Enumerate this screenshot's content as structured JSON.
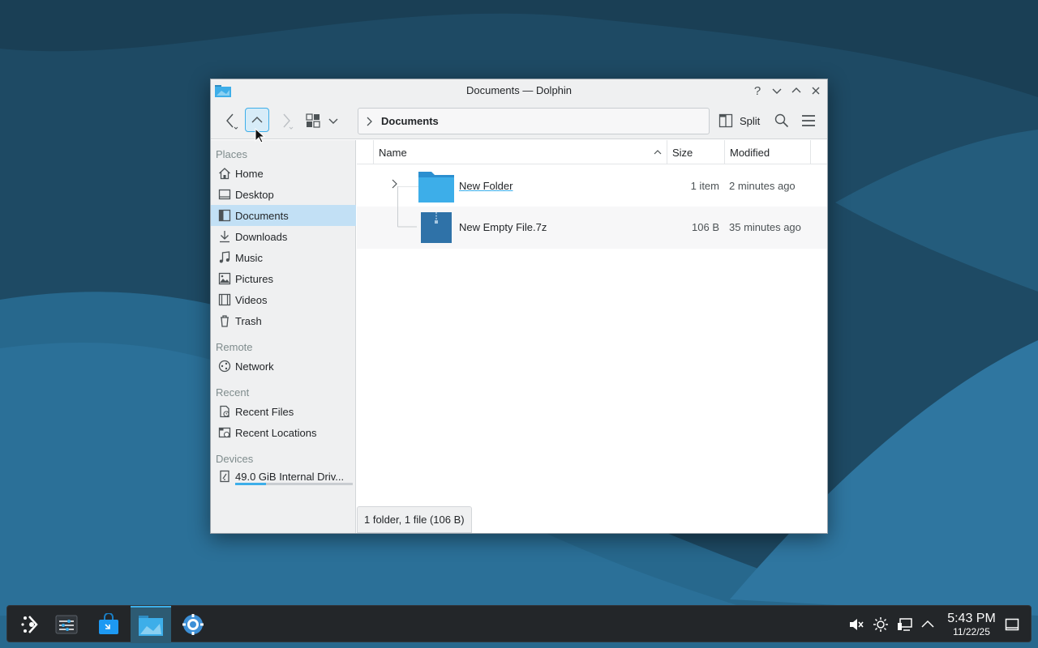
{
  "window": {
    "title": "Documents — Dolphin",
    "buttons": [
      "help-icon",
      "minimize-icon",
      "maximize-icon",
      "close-icon"
    ]
  },
  "toolbar": {
    "breadcrumb": "Documents",
    "split_label": "Split"
  },
  "sidebar": {
    "places_label": "Places",
    "places": [
      {
        "label": "Home",
        "icon": "home-icon"
      },
      {
        "label": "Desktop",
        "icon": "desktop-icon"
      },
      {
        "label": "Documents",
        "icon": "documents-icon",
        "selected": true
      },
      {
        "label": "Downloads",
        "icon": "download-icon"
      },
      {
        "label": "Music",
        "icon": "music-icon"
      },
      {
        "label": "Pictures",
        "icon": "pictures-icon"
      },
      {
        "label": "Videos",
        "icon": "videos-icon"
      },
      {
        "label": "Trash",
        "icon": "trash-icon"
      }
    ],
    "remote_label": "Remote",
    "remote": [
      {
        "label": "Network",
        "icon": "network-icon"
      }
    ],
    "recent_label": "Recent",
    "recent": [
      {
        "label": "Recent Files",
        "icon": "recent-files-icon"
      },
      {
        "label": "Recent Locations",
        "icon": "recent-locations-icon"
      }
    ],
    "devices_label": "Devices",
    "devices": [
      {
        "label": "49.0 GiB Internal Driv...",
        "icon": "drive-icon",
        "used_fraction": 0.26
      }
    ]
  },
  "columns": {
    "name": "Name",
    "size": "Size",
    "modified": "Modified"
  },
  "files": [
    {
      "name": "New Folder",
      "size": "1 item",
      "modified": "2 minutes ago",
      "icon": "folder-icon"
    },
    {
      "name": "New Empty File.7z",
      "size": "106 B",
      "modified": "35 minutes ago",
      "icon": "archive-icon"
    }
  ],
  "status_text": "1 folder, 1 file (106 B)",
  "taskbar": {
    "apps": [
      "app-launcher-icon",
      "system-settings-icon",
      "discover-icon",
      "dolphin-icon",
      "steam-icon"
    ],
    "tray": [
      "volume-muted-icon",
      "brightness-icon",
      "network-wired-icon",
      "expand-tray-icon"
    ],
    "time": "5:43 PM",
    "date": "11/22/25"
  },
  "colors": {
    "accent": "#3daee9",
    "selection": "#c2e0f5",
    "taskbar": "#232629",
    "window_chrome": "#eff0f1"
  }
}
